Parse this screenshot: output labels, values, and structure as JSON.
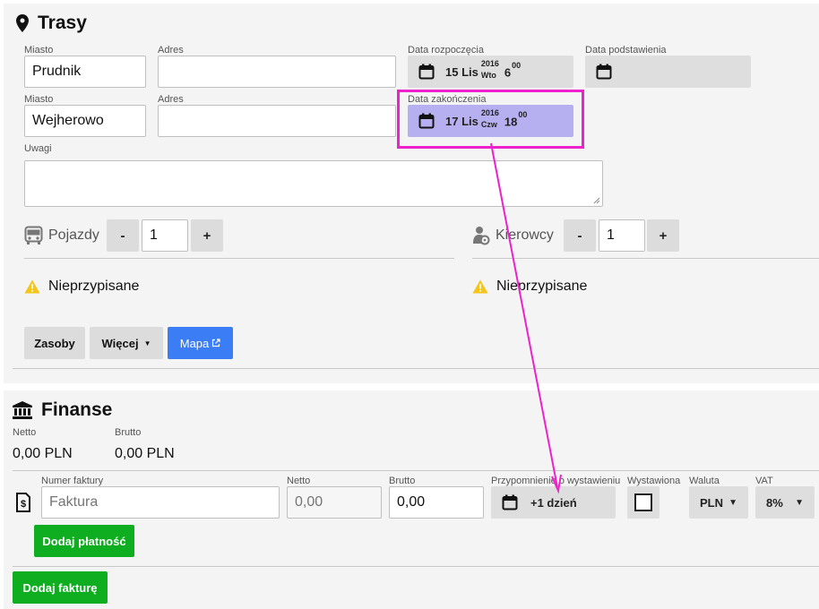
{
  "trasy": {
    "title": "Trasy",
    "route1": {
      "city_label": "Miasto",
      "city_value": "Prudnik",
      "address_label": "Adres",
      "address_value": "",
      "start_label": "Data rozpoczęcia",
      "start": {
        "day": "15 Lis",
        "year": "2016",
        "weekday": "Wto",
        "hour": "6",
        "minutes": "00"
      },
      "sub_label": "Data podstawienia"
    },
    "route2": {
      "city_label": "Miasto",
      "city_value": "Wejherowo",
      "address_label": "Adres",
      "address_value": "",
      "end_label": "Data zakończenia",
      "end": {
        "day": "17 Lis",
        "year": "2016",
        "weekday": "Czw",
        "hour": "18",
        "minutes": "00"
      }
    },
    "notes_label": "Uwagi",
    "vehicles": {
      "label": "Pojazdy",
      "minus": "-",
      "value": "1",
      "plus": "+",
      "status": "Nieprzypisane"
    },
    "drivers": {
      "label": "Kierowcy",
      "minus": "-",
      "value": "1",
      "plus": "+",
      "status": "Nieprzypisane"
    },
    "buttons": {
      "resources": "Zasoby",
      "more": "Więcej",
      "map": "Mapa"
    }
  },
  "finanse": {
    "title": "Finanse",
    "netto_label": "Netto",
    "netto_value": "0,00 PLN",
    "brutto_label": "Brutto",
    "brutto_value": "0,00 PLN",
    "invoice": {
      "number_label": "Numer faktury",
      "number_placeholder": "Faktura",
      "netto_label": "Netto",
      "netto_placeholder": "0,00",
      "brutto_label": "Brutto",
      "brutto_value": "0,00",
      "reminder_label": "Przypomnienie o wystawieniu",
      "reminder_value": "+1 dzień",
      "issued_label": "Wystawiona",
      "currency_label": "Waluta",
      "currency_value": "PLN",
      "vat_label": "VAT",
      "vat_value": "8%"
    },
    "add_payment": "Dodaj płatność",
    "add_invoice": "Dodaj fakturę"
  },
  "colors": {
    "highlight": "#ee22cc",
    "highlight_fill": "#b6b0f0",
    "green": "#0fae20",
    "blue": "#3b7df5",
    "warning": "#f5c518"
  }
}
